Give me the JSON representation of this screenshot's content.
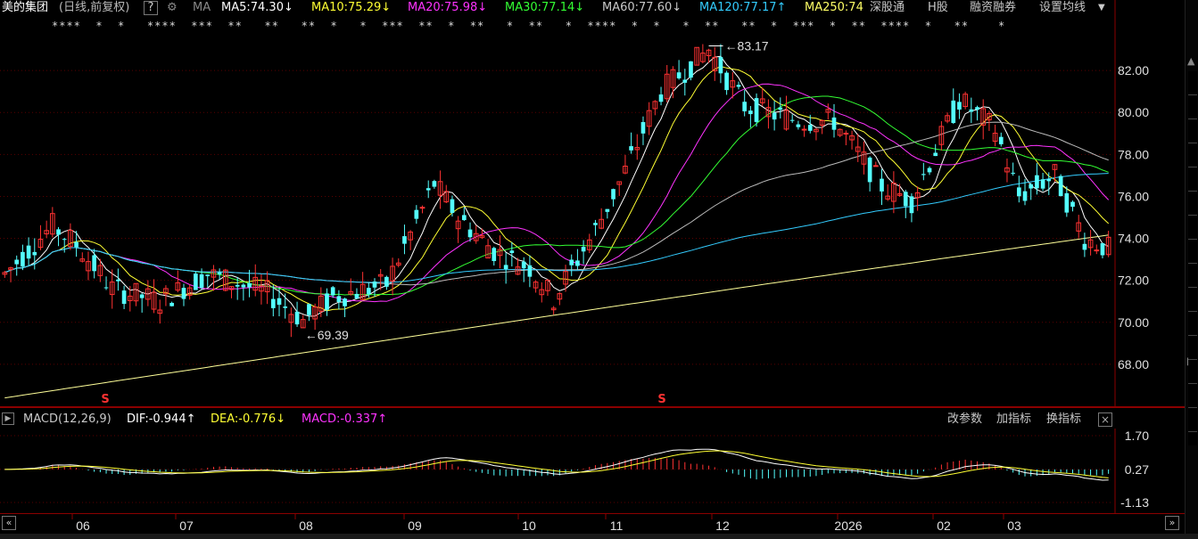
{
  "header": {
    "stock_name": "美的集团",
    "period": "(日线,前复权)",
    "help": "?",
    "ma_label": "MA",
    "indicators": [
      {
        "text": "MA5:74.30",
        "arrow": "↓",
        "color": "#ffffff"
      },
      {
        "text": "MA10:75.29",
        "arrow": "↓",
        "color": "#ffff33"
      },
      {
        "text": "MA20:75.98",
        "arrow": "↓",
        "color": "#ff33ff"
      },
      {
        "text": "MA30:77.14",
        "arrow": "↓",
        "color": "#33ff33"
      },
      {
        "text": "MA60:77.60",
        "arrow": "↓",
        "color": "#c8c8c8"
      },
      {
        "text": "MA120:77.17",
        "arrow": "↑",
        "color": "#33ccff"
      },
      {
        "text": "MA250:74",
        "arrow": "",
        "color": "#ffff66"
      }
    ],
    "links": [
      "深股通",
      "H股",
      "融资融券",
      "设置均线"
    ]
  },
  "events_row": "****  *  *   ****  ***  **   **   **  *   *  ***  **  *  **   *  **   *  ****  *  *   *  **   **  *  ***  *  **  ****  *   **    *",
  "main_chart": {
    "y_ticks": [
      "82.00",
      "80.00",
      "78.00",
      "76.00",
      "74.00",
      "72.00",
      "70.00",
      "68.00"
    ],
    "high_label": "83.17",
    "low_label": "69.39",
    "s_marker": "S"
  },
  "macd": {
    "label": "MACD(12,26,9)",
    "dif": "DIF:-0.944",
    "dif_arrow": "↑",
    "dea": "DEA:-0.776",
    "dea_arrow": "↓",
    "macd": "MACD:-0.337",
    "macd_arrow": "↑",
    "colors": {
      "dif": "#ffffff",
      "dea": "#ffff33",
      "macd": "#ff33ff"
    },
    "buttons": [
      "改参数",
      "加指标",
      "换指标"
    ],
    "close": "×",
    "y_ticks": [
      "1.70",
      "0.27",
      "-1.13"
    ]
  },
  "x_axis": {
    "labels": [
      "06",
      "07",
      "08",
      "09",
      "10",
      "11",
      "12",
      "2026",
      "02",
      "03"
    ]
  },
  "colors": {
    "up": "#ff3232",
    "down": "#54ffff",
    "grid": "#8b0000"
  },
  "chart_data": {
    "type": "candlestick",
    "y_range": [
      66,
      84
    ],
    "annotated_high": 83.17,
    "annotated_low": 69.39,
    "ma_values": {
      "MA5": 74.3,
      "MA10": 75.29,
      "MA20": 75.98,
      "MA30": 77.14,
      "MA60": 77.6,
      "MA120": 77.17,
      "MA250": 74
    },
    "macd_y_range": [
      -1.13,
      1.7
    ]
  }
}
